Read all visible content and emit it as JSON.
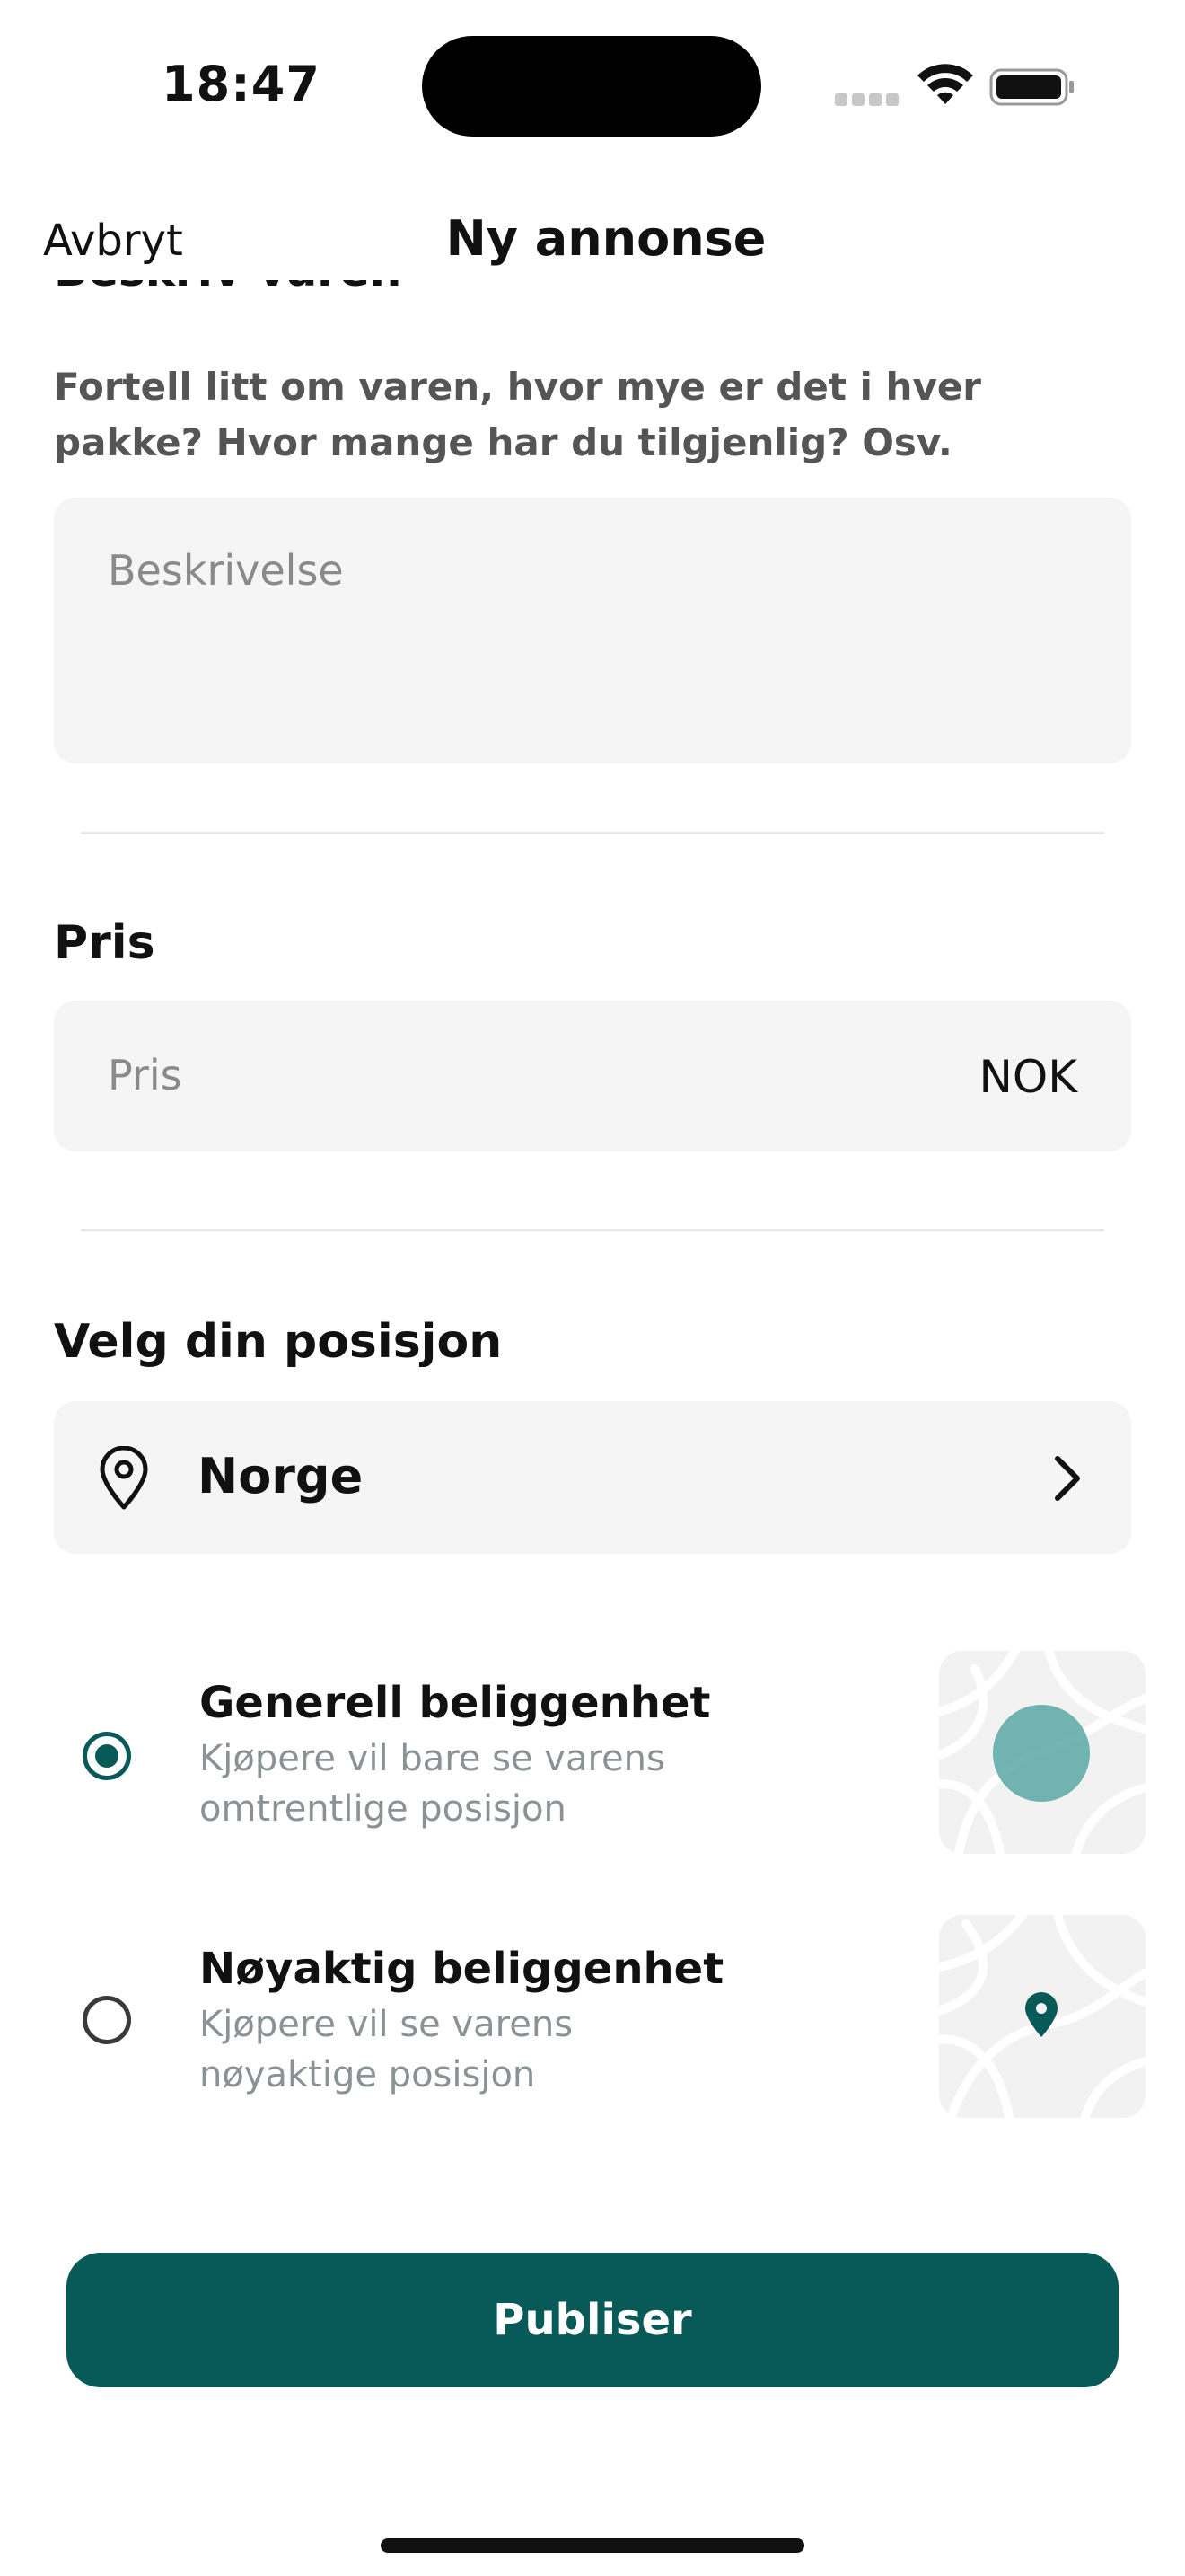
{
  "status_bar": {
    "time": "18:47"
  },
  "nav": {
    "cancel_label": "Avbryt",
    "title": "Ny annonse"
  },
  "description_section": {
    "heading": "Beskriv varen",
    "helper": "Fortell litt om varen, hvor mye er det i hver pakke? Hvor mange har du tilgjenlig? Osv.",
    "placeholder": "Beskrivelse"
  },
  "price_section": {
    "heading": "Pris",
    "placeholder": "Pris",
    "currency": "NOK"
  },
  "location_section": {
    "heading": "Velg din posisjon",
    "value": "Norge"
  },
  "visibility_options": [
    {
      "title": "Generell beliggenhet",
      "description": "Kjøpere vil bare se varens omtrentlige posisjon",
      "selected": true,
      "icon": "map-area-circle-icon"
    },
    {
      "title": "Nøyaktig beliggenhet",
      "description": "Kjøpere vil se varens nøyaktige posisjon",
      "selected": false,
      "icon": "map-pin-icon"
    }
  ],
  "publish_label": "Publiser",
  "colors": {
    "accent": "#075a58",
    "field_background": "#f5f5f5",
    "secondary_text": "#8a9296"
  }
}
